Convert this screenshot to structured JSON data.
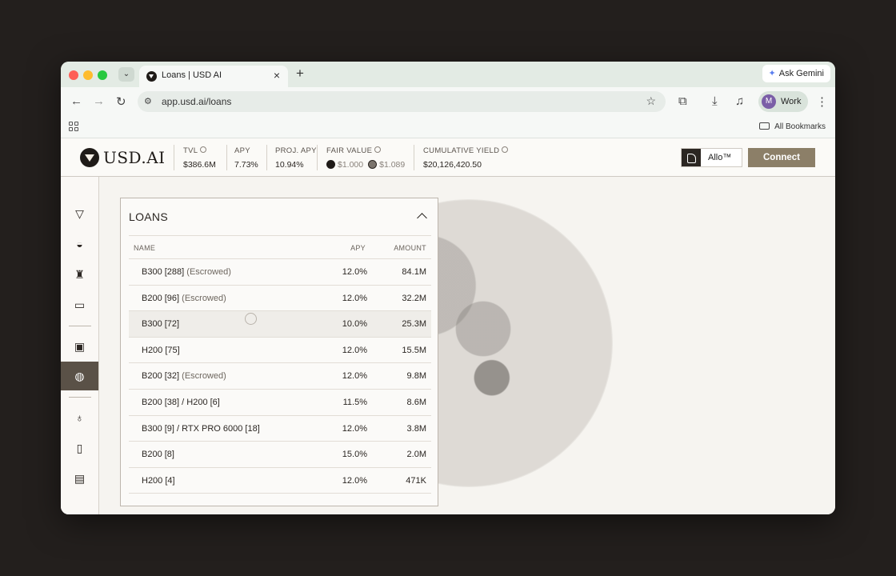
{
  "browser": {
    "tab_title": "Loans | USD AI",
    "url": "app.usd.ai/loans",
    "gemini_label": "Ask Gemini",
    "profile_initial": "M",
    "profile_label": "Work",
    "bookmarks_label": "All Bookmarks"
  },
  "header": {
    "logo_text": "USD.AI",
    "stats": {
      "tvl": {
        "label": "TVL",
        "value": "$386.6M"
      },
      "apy": {
        "label": "APY",
        "value": "7.73%"
      },
      "proj_apy": {
        "label": "PROJ. APY",
        "value": "10.94%"
      },
      "fair_value": {
        "label": "FAIR VALUE",
        "value_1": "$1.000",
        "value_2": "$1.089"
      },
      "cumulative_yield": {
        "label": "CUMULATIVE YIELD",
        "value": "$20,126,420.50"
      }
    },
    "allo_label": "Allo™",
    "connect_label": "Connect"
  },
  "sidebar": {
    "items": [
      "diamond-icon",
      "wifi-icon",
      "seat-icon",
      "folder-icon",
      "dashboard-icon",
      "globe-icon",
      "lightbulb-icon",
      "document-icon",
      "newspaper-icon"
    ],
    "active": "globe-icon"
  },
  "loans": {
    "title": "LOANS",
    "columns": {
      "name": "NAME",
      "apy": "APY",
      "amount": "AMOUNT"
    },
    "rows": [
      {
        "name": "B300 [288]",
        "tag": "(Escrowed)",
        "apy": "12.0%",
        "amount": "84.1M"
      },
      {
        "name": "B200 [96]",
        "tag": "(Escrowed)",
        "apy": "12.0%",
        "amount": "32.2M"
      },
      {
        "name": "B300 [72]",
        "tag": "",
        "apy": "10.0%",
        "amount": "25.3M"
      },
      {
        "name": "H200 [75]",
        "tag": "",
        "apy": "12.0%",
        "amount": "15.5M"
      },
      {
        "name": "B200 [32]",
        "tag": "(Escrowed)",
        "apy": "12.0%",
        "amount": "9.8M"
      },
      {
        "name": "B200 [38] / H200 [6]",
        "tag": "",
        "apy": "11.5%",
        "amount": "8.6M"
      },
      {
        "name": "B300 [9] / RTX PRO 6000 [18]",
        "tag": "",
        "apy": "12.0%",
        "amount": "3.8M"
      },
      {
        "name": "B200 [8]",
        "tag": "",
        "apy": "15.0%",
        "amount": "2.0M"
      },
      {
        "name": "H200 [4]",
        "tag": "",
        "apy": "12.0%",
        "amount": "471K"
      }
    ]
  }
}
